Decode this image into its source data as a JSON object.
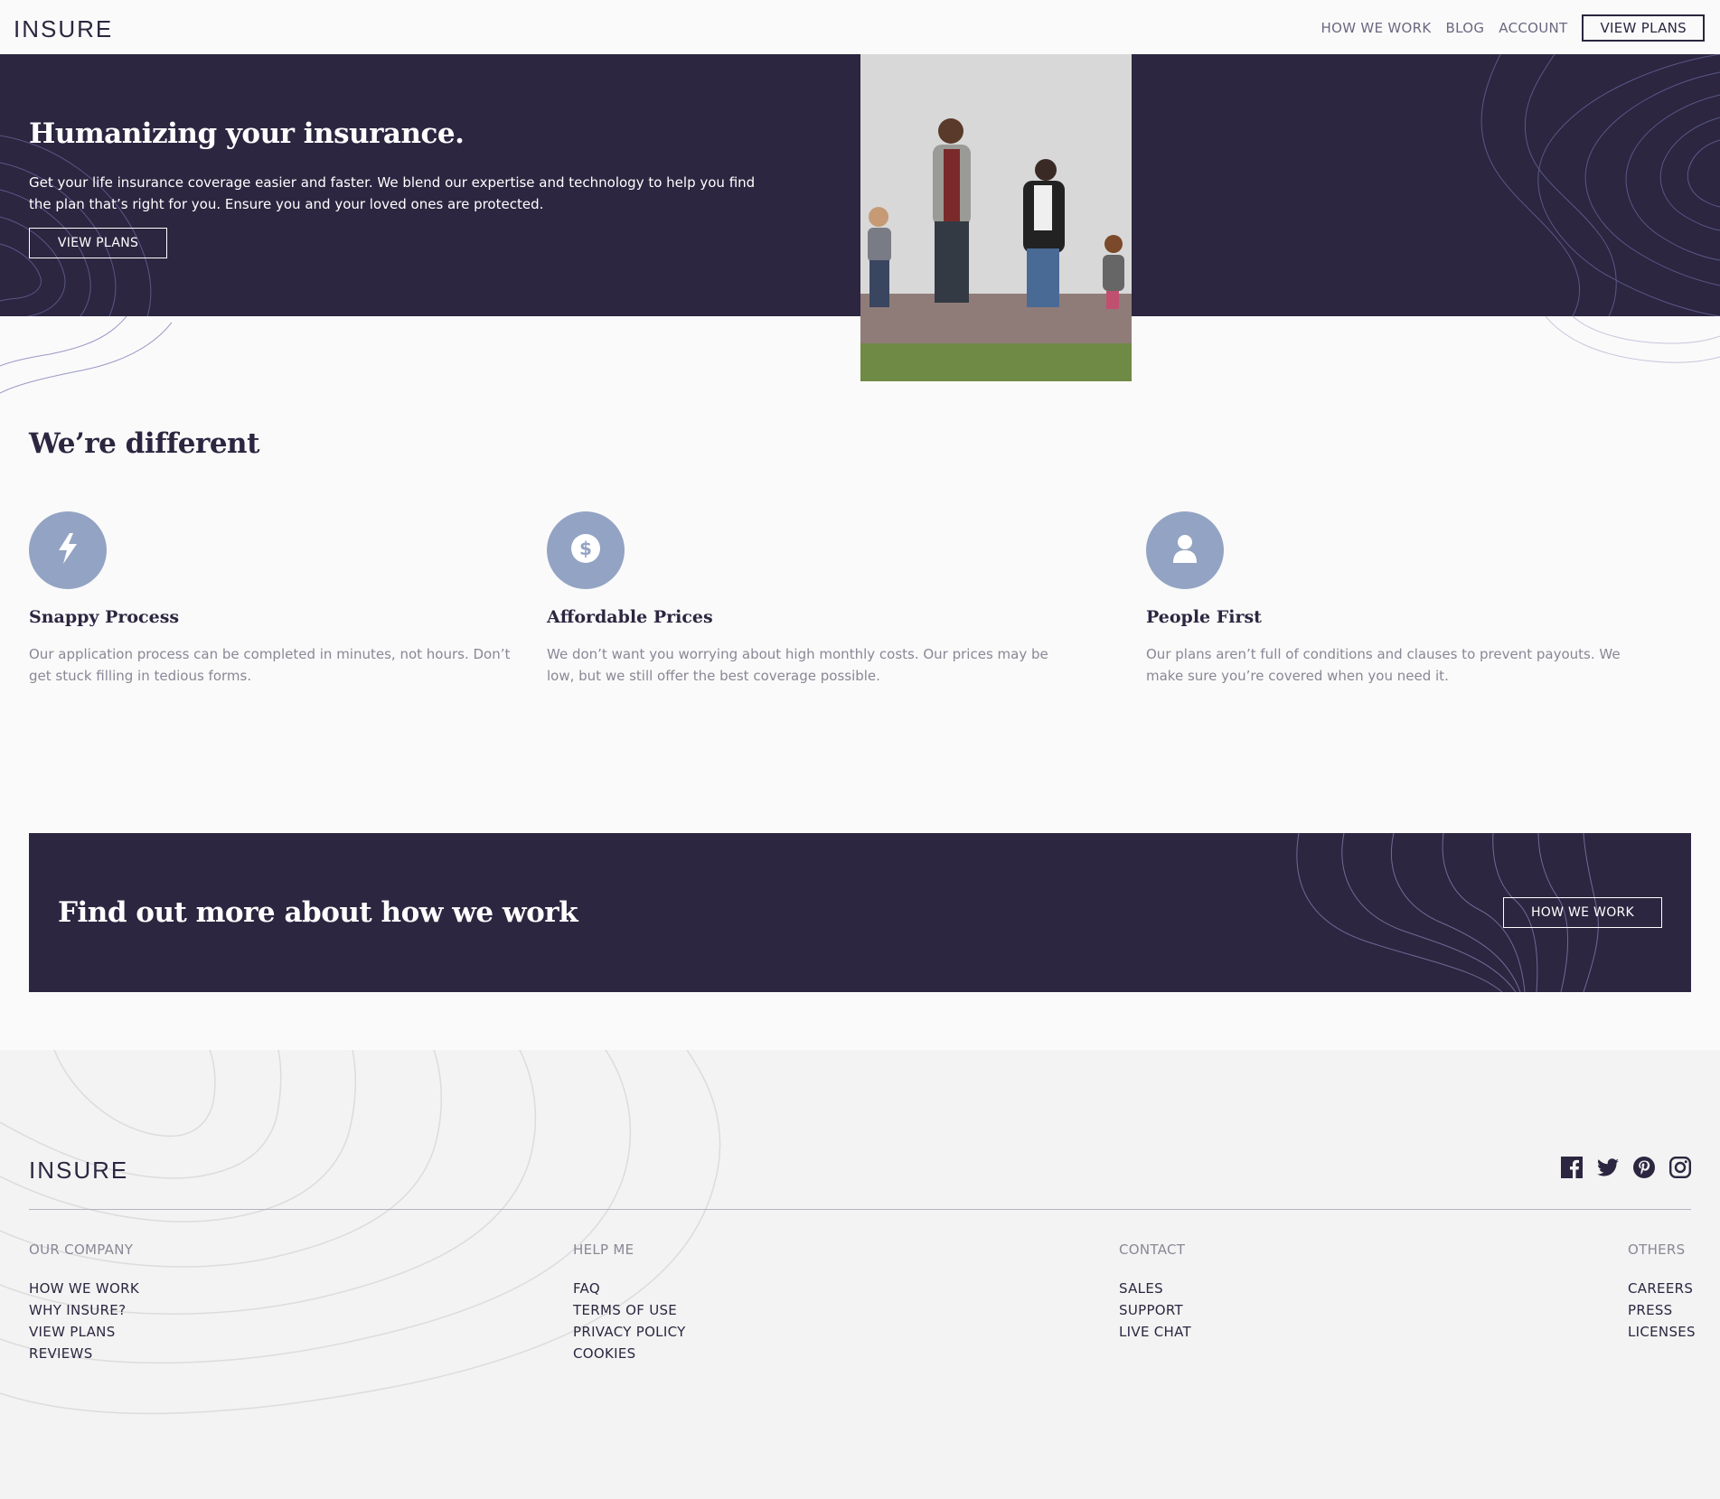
{
  "header": {
    "logo": "INSURE",
    "nav": [
      "HOW WE WORK",
      "BLOG",
      "ACCOUNT"
    ],
    "cta": "VIEW PLANS"
  },
  "hero": {
    "title": "Humanizing your insurance.",
    "text": "Get your life insurance coverage easier and faster. We blend our expertise and technology to help you find the plan that’s right for you. Ensure you and your loved ones are protected.",
    "button": "VIEW PLANS"
  },
  "different": {
    "title": "We’re different",
    "features": [
      {
        "icon": "lightning-icon",
        "title": "Snappy Process",
        "text": "Our application process can be completed in minutes, not hours. Don’t get stuck filling in tedious forms."
      },
      {
        "icon": "dollar-icon",
        "title": "Affordable Prices",
        "text": "We don’t want you worrying about high monthly costs. Our prices may be low, but we still offer the best coverage possible."
      },
      {
        "icon": "person-icon",
        "title": "People First",
        "text": "Our plans aren’t full of conditions and clauses to prevent payouts. We make sure you’re covered when you need it."
      }
    ]
  },
  "cta": {
    "title": "Find out more about how we work",
    "button": "HOW WE WORK"
  },
  "footer": {
    "logo": "INSURE",
    "social": [
      "facebook-icon",
      "twitter-icon",
      "pinterest-icon",
      "instagram-icon"
    ],
    "columns": [
      {
        "heading": "OUR COMPANY",
        "links": [
          "HOW WE WORK",
          "WHY INSURE?",
          "VIEW PLANS",
          "REVIEWS"
        ]
      },
      {
        "heading": "HELP ME",
        "links": [
          "FAQ",
          "TERMS OF USE",
          "PRIVACY POLICY",
          "COOKIES"
        ]
      },
      {
        "heading": "CONTACT",
        "links": [
          "SALES",
          "SUPPORT",
          "LIVE CHAT"
        ]
      },
      {
        "heading": "OTHERS",
        "links": [
          "CAREERS",
          "PRESS",
          "LICENSES"
        ]
      }
    ]
  },
  "colors": {
    "dark": "#2c2640",
    "icon_bg": "#93a3c3",
    "muted": "#8a8796",
    "footer_bg": "#f3f3f3"
  }
}
